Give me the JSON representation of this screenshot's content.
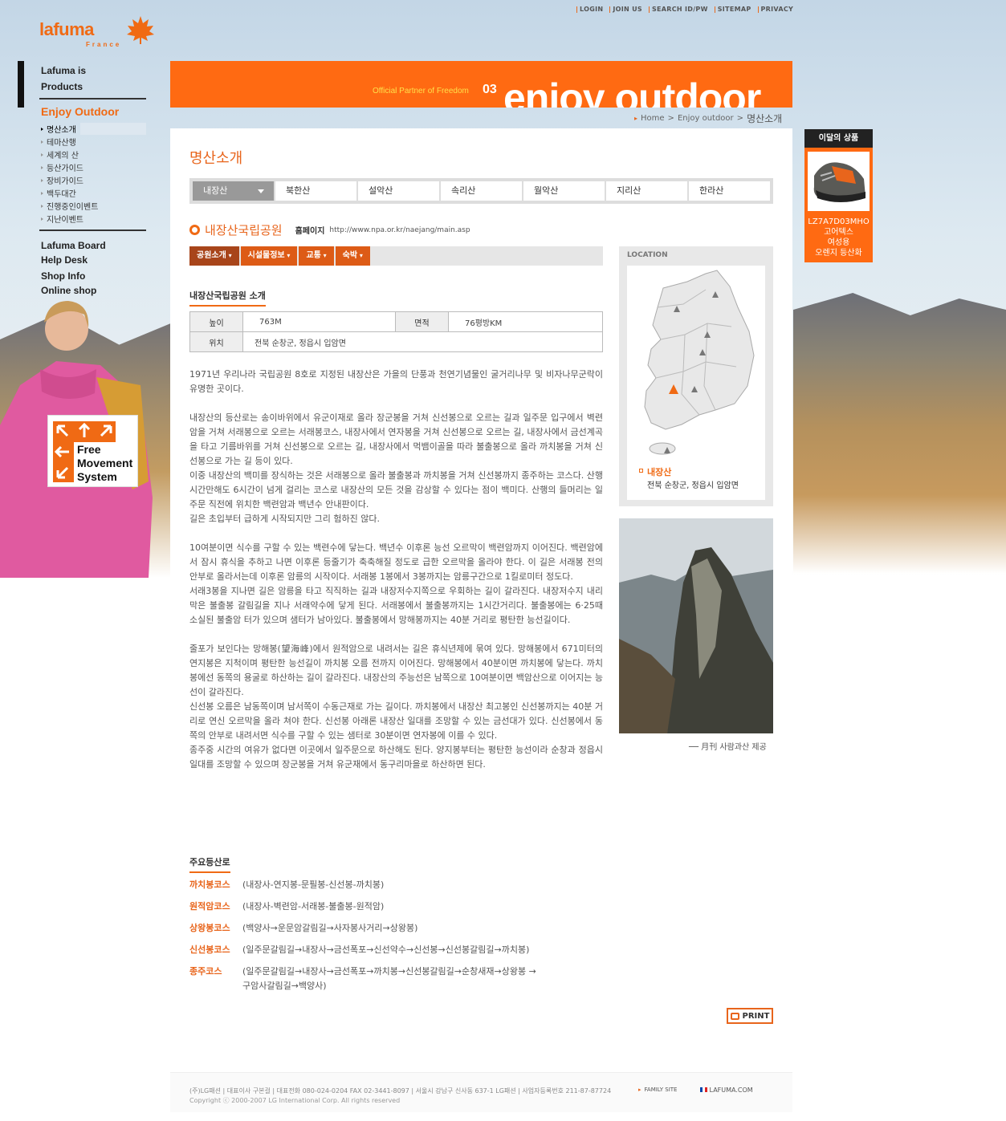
{
  "top_nav": [
    "LOGIN",
    "JOIN US",
    "SEARCH ID/PW",
    "SITEMAP",
    "PRIVACY"
  ],
  "logo": {
    "word": "lafuma",
    "sub": "France"
  },
  "left_nav": {
    "about": "Lafuma is",
    "products": "Products",
    "enjoy": "Enjoy Outdoor",
    "sub": [
      "명산소개",
      "테마산행",
      "세계의 산",
      "등산가이드",
      "장비가이드",
      "백두대간",
      "진행중인이벤트",
      "지난이벤트"
    ],
    "board": "Lafuma Board",
    "help": "Help Desk",
    "shop": "Shop Info",
    "online": "Online shop"
  },
  "fms": [
    "Free",
    "Movement",
    "System"
  ],
  "banner": {
    "tag": "Official Partner of Freedom",
    "num": "03",
    "big": "enjoy outdoor"
  },
  "breadcrumb": [
    "Home",
    ">",
    "Enjoy outdoor",
    ">",
    "명산소개"
  ],
  "month": {
    "title": "이달의 상품",
    "code": "LZ7A7D03MHO",
    "lines": [
      "고어텍스",
      "여성용",
      "오렌지 등산화"
    ]
  },
  "page_title": "명산소개",
  "tabs": [
    "내장산",
    "북한산",
    "설악산",
    "속리산",
    "월악산",
    "지리산",
    "한라산"
  ],
  "park": {
    "name": "내장산국립공원",
    "hp_label": "홈페이지",
    "hp": "http://www.npa.or.kr/naejang/main.asp"
  },
  "subtabs": [
    "공원소개",
    "시설물정보",
    "교통",
    "숙박"
  ],
  "intro_heading": "내장산국립공원 소개",
  "info": {
    "height_label": "높이",
    "height": "763M",
    "area_label": "면적",
    "area": "76평방KM",
    "loc_label": "위치",
    "loc": "전북 순창군, 정읍시 입암면"
  },
  "paragraphs": [
    "1971년 우리나라 국립공원 8호로 지정된 내장산은 가을의 단풍과 천연기념물인 굴거리나무 및 비자나무군락이 유명한 곳이다.",
    "내장산의 등산로는 송이바위에서 유군이재로 올라 장군봉을 거쳐 신선봉으로 오르는 길과 일주문 입구에서 벽련암을 거쳐 서래봉으로 오르는 서래봉코스, 내장사에서 연자봉을 거쳐 신선봉으로 오르는 길, 내장사에서 금선계곡을 타고 기름바위를 거쳐 신선봉으로 오르는 길, 내장사에서 먹뱀이골을 따라 불출봉으로 올라 까치봉을 거쳐 신선봉으로 가는 길 등이 있다.\n이중 내장산의 백미를 장식하는 것은 서래봉으로 올라 불출봉과 까치봉을 거쳐 신선봉까지 종주하는 코스다. 산행시간만해도 6시간이 넘게 걸리는 코스로 내장산의 모든 것을 감상할 수 있다는 점이 백미다. 산행의 들머리는 일주문 직전에 위치한 백련암과 백년수 안내판이다.\n길은 초입부터 급하게 시작되지만 그리 험하진 않다.",
    "10여분이면 식수를 구할 수 있는 백련수에 닿는다. 백년수 이후론 능선 오르막이 백련암까지 이어진다. 백련암에서 잠시 휴식을 추하고 나면 이후론 등줄기가 축축해질 정도로 급한 오르막을 올라야 한다. 이 길은 서래봉 전의 안부로 올라서는데 이후론 암릉의 시작이다. 서래봉 1봉에서 3봉까지는 암릉구간으로 1킬로미터 정도다.\n서래3봉을 지나면 길은 암릉을 타고 직직하는 길과 내장저수지쪽으로 우회하는 길이 갈라진다. 내장저수지 내리막은 불출봉 갈림길을 지나 서래약수에 닿게 된다. 서래봉에서 불출봉까지는 1시간거리다. 불출봉에는 6·25때 소실된 불출암 터가 있으며 샘터가 남아있다. 불출봉에서 망해봉까지는 40분 거리로 평탄한 능선길이다.",
    "줄포가 보인다는 망해봉(望海峰)에서 원적암으로 내려서는 길은 휴식년제에 묶여 있다. 망해봉에서 671미터의 연지봉은 지척이며 평탄한 능선길이 까치봉 오름 전까지 이어진다. 망해봉에서 40분이면 까치봉에 닿는다. 까치봉에선 동쪽의 용굴로 하산하는 길이 갈라진다. 내장산의 주능선은 남쪽으로 10여분이면 백암산으로 이어지는 능선이 갈라진다.\n신선봉 오름은 남동쪽이며 남서쪽이 수동근재로 가는 길이다. 까치봉에서 내장산 최고봉인 신선봉까지는 40분 거리로 연신 오르막을 올라 쳐야 한다. 신선봉 아래론 내장산 일대를 조망할 수 있는 금선대가 있다. 신선봉에서 동쪽의 안부로 내려서면 식수를 구할 수 있는 샘터로 30분이면 연자봉에 이를 수 있다.\n종주중 시간의 여유가 없다면 이곳에서 일주문으로 하산해도 된다. 양지봉부터는 평탄한 능선이라 순창과 정읍시 일대를 조망할 수 있으며 장군봉을 거쳐 유군재에서 동구리마을로 하산하면 된다."
  ],
  "routes_heading": "주요등산로",
  "routes": [
    {
      "name": "까치봉코스",
      "path": "(내장사-연지봉-문필봉-신선봉-까치봉)"
    },
    {
      "name": "원적암코스",
      "path": "(내장사-벽련암-서래봉-불출봉-원적암)"
    },
    {
      "name": "상왕봉코스",
      "path": "(백양사→운문암갈림길→사자봉사거리→상왕봉)"
    },
    {
      "name": "신선봉코스",
      "path": "(일주문갈림길→내장사→금선폭포→신선약수→신선봉→신선봉갈림길→까치봉)"
    },
    {
      "name": "종주코스",
      "path": "(일주문갈림길→내장사→금선폭포→까치봉→신선봉갈림길→순창새재→상왕봉 →\n 구암사갈림길→백양사)"
    }
  ],
  "location": {
    "label": "LOCATION",
    "name": "내장산",
    "addr": "전북 순창군, 정읍시 입암면"
  },
  "photo_caption": "月刊 사람과산 제공",
  "print": "PRINT",
  "footer": {
    "line1": "(주)LG패션 | 대표이사 구본걸 | 대표전화 080-024-0204  FAX 02-3441-8097 | 서울시 강남구 신사동 637-1 LG패션 | 사업자등록번호 211-87-87724",
    "line2": "Copyright ⓒ 2000-2007 LG International Corp. All rights reserved",
    "family": "FAMILY SITE",
    "lafuma": "LAFUMA.COM"
  },
  "colors": {
    "accent": "#f06a14",
    "banner": "#ff6a12"
  }
}
